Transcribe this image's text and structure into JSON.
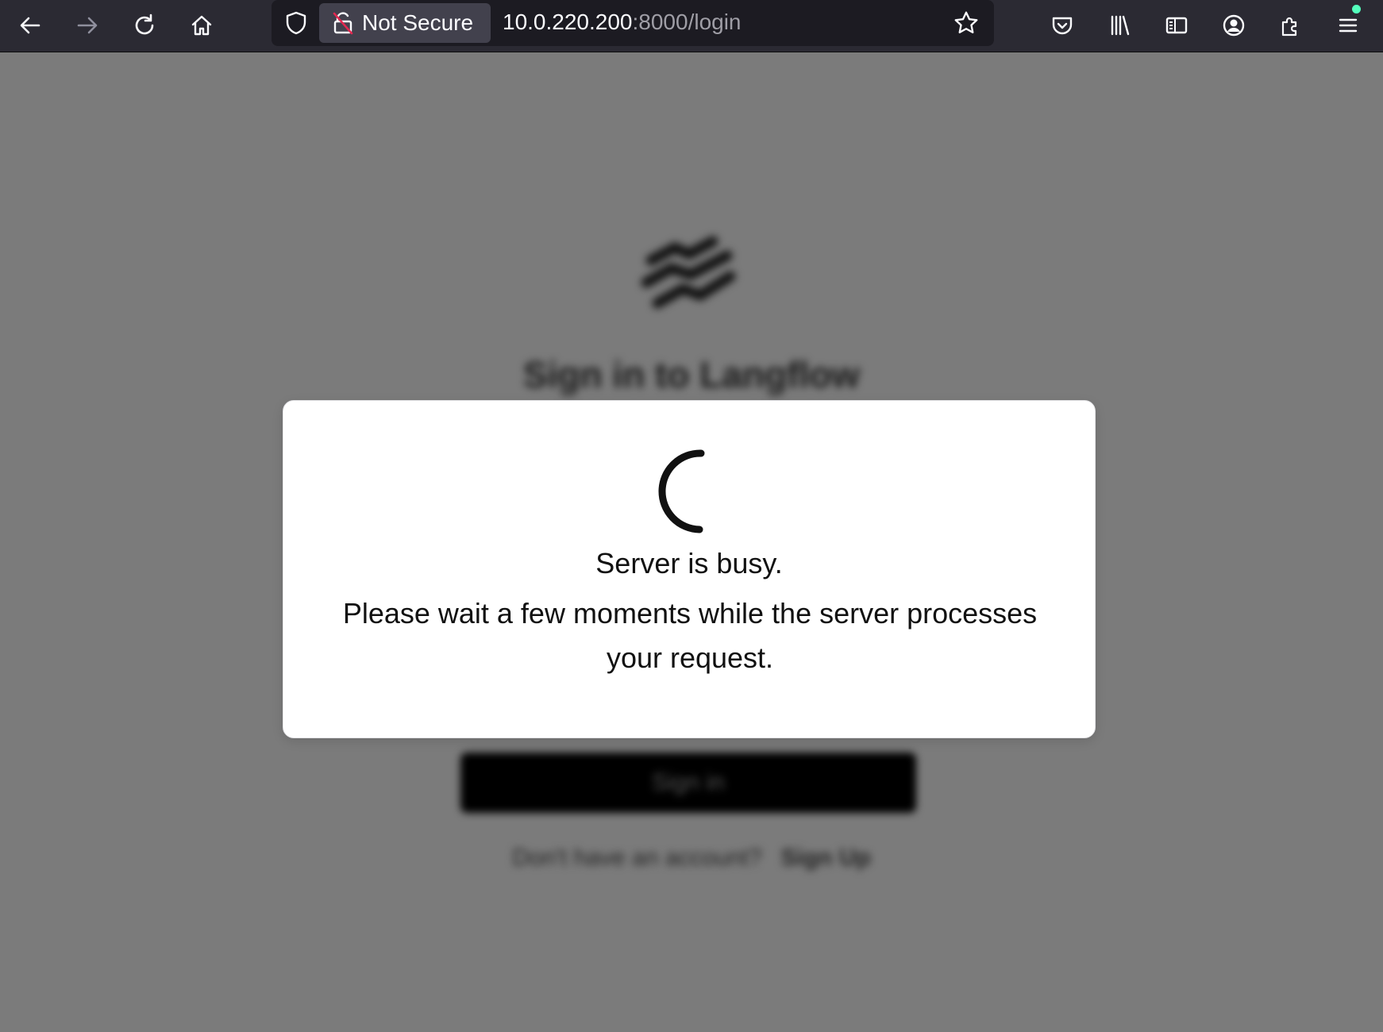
{
  "browser": {
    "security_label": "Not Secure",
    "url_host": "10.0.220.200",
    "url_rest": ":8000/login",
    "notification_color": "#54ffbd",
    "icons": [
      "back-arrow-icon",
      "forward-arrow-icon",
      "reload-icon",
      "home-icon",
      "shield-icon",
      "insecure-lock-icon",
      "bookmark-star-icon",
      "pocket-icon",
      "library-icon",
      "sidebar-icon",
      "account-icon",
      "extensions-icon",
      "hamburger-menu-icon"
    ]
  },
  "login_page": {
    "title": "Sign in to Langflow",
    "signin_button": "Sign in",
    "signup_prompt": "Don't have an account?",
    "signup_link": "Sign Up"
  },
  "modal": {
    "title": "Server is busy.",
    "message": "Please wait a few moments while the server processes your request."
  }
}
